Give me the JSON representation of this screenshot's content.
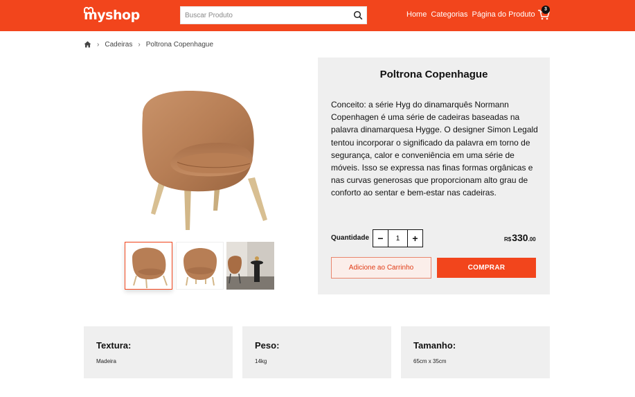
{
  "header": {
    "logo": "myshop",
    "search_placeholder": "Buscar Produto",
    "nav": [
      "Home",
      "Categorias",
      "Página do Produto"
    ],
    "cart_count": "3",
    "brand_color": "#f2451c"
  },
  "breadcrumb": [
    "Cadeiras",
    "Poltrona Copenhague"
  ],
  "product": {
    "title": "Poltrona Copenhague",
    "description": "Conceito: a série Hyg do dinamarquês Normann Copenhagen é uma série de cadeiras baseadas na palavra dinamarquesa Hygge. O designer Simon Legald tentou incorporar o significado da palavra em torno de segurança, calor e conveniência em uma série de móveis. Isso se expressa nas finas formas orgânicas e nas curvas generosas que proporcionam alto grau de conforto ao sentar e bem-estar nas cadeiras.",
    "quantity_label": "Quantidade",
    "quantity": "1",
    "price_currency": "R$",
    "price_main": "330",
    "price_cents": ".00",
    "add_to_cart": "Adicione ao Carrinho",
    "buy": "COMPRAR"
  },
  "specs": [
    {
      "title": "Textura:",
      "value": "Madeira"
    },
    {
      "title": "Peso:",
      "value": "14kg"
    },
    {
      "title": "Tamanho:",
      "value": "65cm x 35cm"
    }
  ],
  "icons": [
    "home-icon",
    "search-icon",
    "cart-icon",
    "chevron-right-icon"
  ]
}
